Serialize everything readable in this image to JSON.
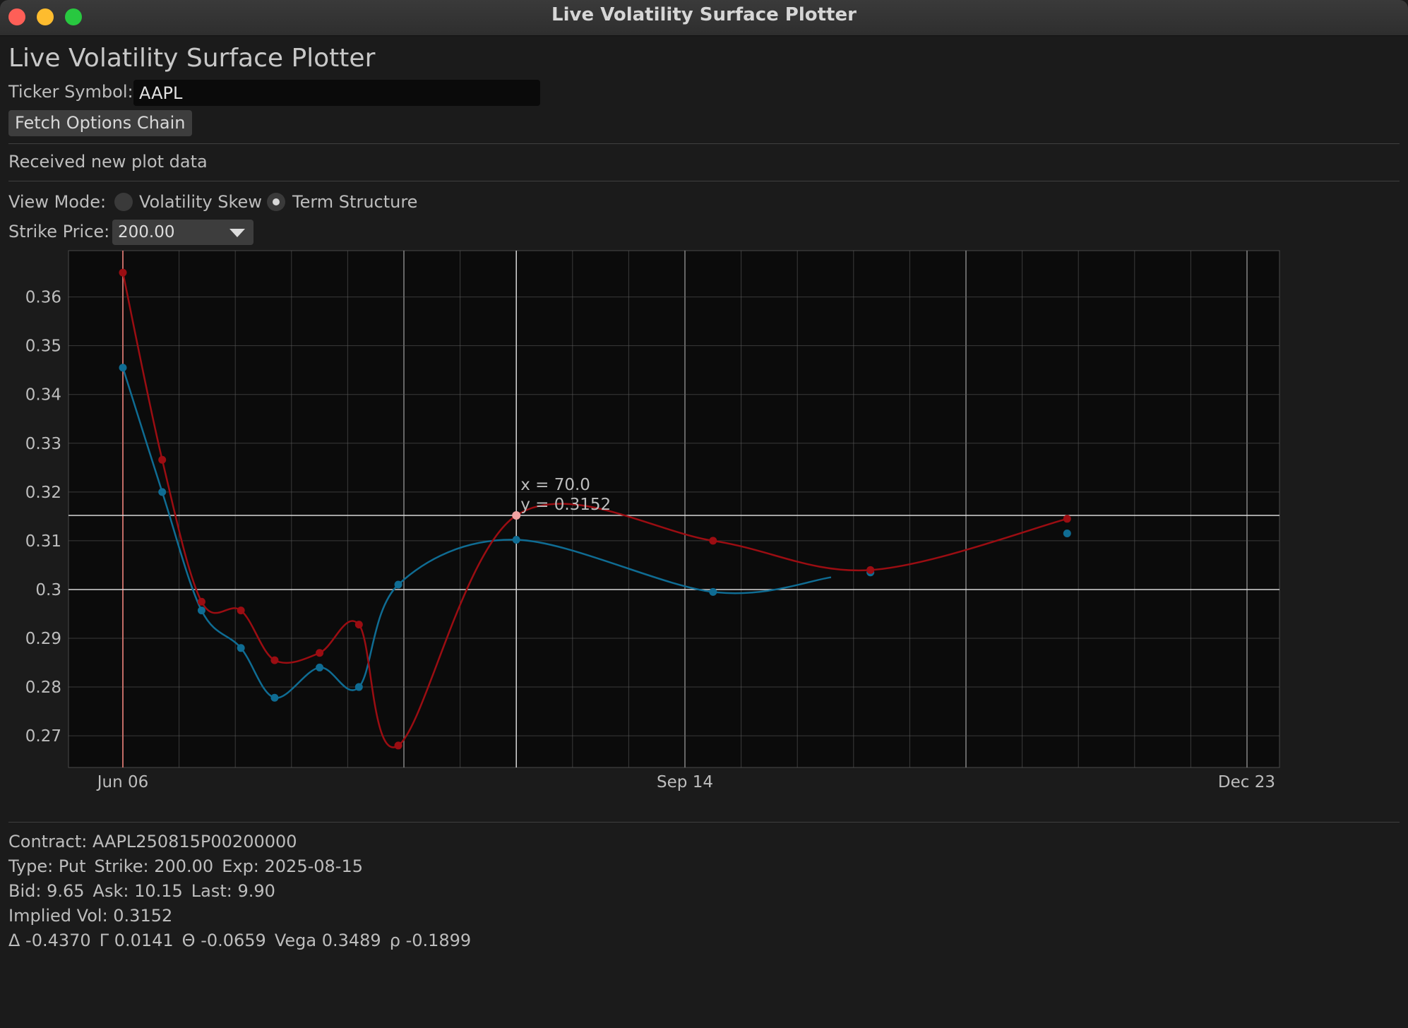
{
  "window": {
    "title": "Live Volatility Surface Plotter"
  },
  "app": {
    "heading": "Live Volatility Surface Plotter",
    "ticker_label": "Ticker Symbol:",
    "ticker_value": "AAPL",
    "fetch_label": "Fetch Options Chain",
    "status": "Received new plot data",
    "view_mode_label": "View Mode:",
    "view_modes": [
      {
        "label": "Volatility Skew",
        "selected": false
      },
      {
        "label": "Term Structure",
        "selected": true
      }
    ],
    "strike_label": "Strike Price:",
    "strike_value": "200.00"
  },
  "colors": {
    "red_series": "#9b0d12",
    "blue_series": "#0f6c93",
    "grid": "#5a5a5a",
    "cursor": "#d8d8d8",
    "origin_line": "#e9766f",
    "plot_bg": "#0b0b0b"
  },
  "chart_data": {
    "type": "line",
    "x_start_label": "Jun 06",
    "xlim": [
      0,
      200
    ],
    "ylim": [
      0.2635,
      0.3695
    ],
    "x_ticks": [
      {
        "x": 0,
        "label": "Jun 06"
      },
      {
        "x": 100,
        "label": "Sep 14"
      },
      {
        "x": 200,
        "label": "Dec 23"
      }
    ],
    "y_ticks": [
      {
        "y": 0.27,
        "label": "0.27"
      },
      {
        "y": 0.28,
        "label": "0.28"
      },
      {
        "y": 0.29,
        "label": "0.29"
      },
      {
        "y": 0.3,
        "label": "0.3"
      },
      {
        "y": 0.31,
        "label": "0.31"
      },
      {
        "y": 0.32,
        "label": "0.32"
      },
      {
        "y": 0.33,
        "label": "0.33"
      },
      {
        "y": 0.34,
        "label": "0.34"
      },
      {
        "y": 0.35,
        "label": "0.35"
      },
      {
        "y": 0.36,
        "label": "0.36"
      }
    ],
    "series": [
      {
        "color": "#0f6c93",
        "points": [
          [
            0,
            0.3455
          ],
          [
            7,
            0.32
          ],
          [
            14,
            0.2957
          ],
          [
            21,
            0.288
          ],
          [
            27,
            0.2778
          ],
          [
            35,
            0.284
          ],
          [
            42,
            0.28
          ],
          [
            49,
            0.301
          ],
          [
            70,
            0.3102
          ],
          [
            105,
            0.2995
          ],
          [
            133,
            0.3035
          ],
          [
            168,
            0.3115
          ]
        ],
        "curve_end": [
          126,
          0.3025
        ]
      },
      {
        "color": "#9b0d12",
        "points": [
          [
            0,
            0.365
          ],
          [
            7,
            0.3266
          ],
          [
            14,
            0.2975
          ],
          [
            21,
            0.2957
          ],
          [
            27,
            0.2855
          ],
          [
            35,
            0.287
          ],
          [
            42,
            0.2928
          ],
          [
            49,
            0.268
          ],
          [
            70,
            0.3152
          ],
          [
            105,
            0.31
          ],
          [
            133,
            0.304
          ],
          [
            168,
            0.3145
          ]
        ]
      }
    ],
    "cursor": {
      "x": 70,
      "y": 0.3152,
      "label_x": "x = 70.0",
      "label_y": "y = 0.3152"
    },
    "h_ref_line": 0.3
  },
  "contract": {
    "contract_line": "Contract: AAPL250815P00200000",
    "type_line": [
      "Type: Put",
      "Strike: 200.00",
      "Exp: 2025-08-15"
    ],
    "quote_line": [
      "Bid: 9.65",
      "Ask: 10.15",
      "Last: 9.90"
    ],
    "iv_line": "Implied Vol: 0.3152",
    "greeks": [
      "Δ -0.4370",
      "Γ 0.0141",
      "Θ -0.0659",
      "Vega 0.3489",
      "ρ -0.1899"
    ]
  }
}
